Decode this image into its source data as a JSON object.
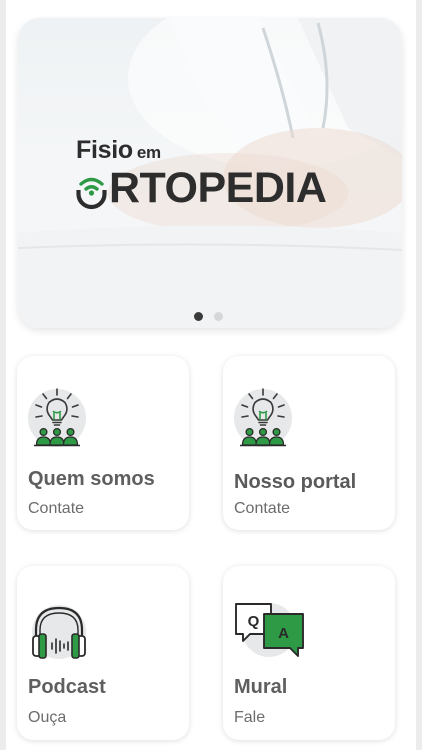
{
  "banner": {
    "brand_line1": "Fisio",
    "brand_line1_small": "em",
    "brand_line2": "RTOPEDIA",
    "slide_count": 2,
    "active_slide": 1
  },
  "cards": [
    {
      "title": "Quem somos",
      "subtitle": "Contate",
      "icon": "bulb-group-icon"
    },
    {
      "title": "Nosso portal",
      "subtitle": "Contate",
      "icon": "bulb-group-icon"
    },
    {
      "title": "Podcast",
      "subtitle": "Ouça",
      "icon": "headphones-icon"
    },
    {
      "title": "Mural",
      "subtitle": "Fale",
      "icon": "qa-chat-icon"
    }
  ],
  "colors": {
    "accent": "#2f9a46",
    "text": "#5f5f5f",
    "brand_text": "#2d2d2d"
  }
}
